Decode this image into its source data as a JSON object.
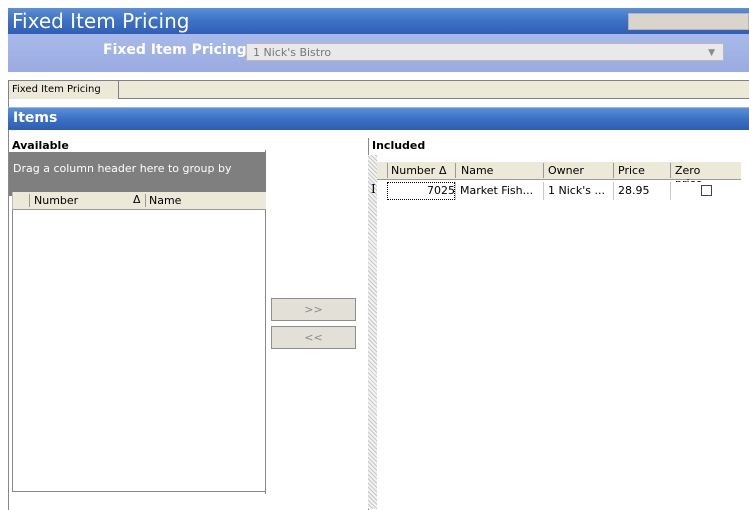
{
  "window": {
    "title": "Fixed Item Pricing"
  },
  "selector": {
    "label": "Fixed Item Pricing:",
    "value": "1  Nick's Bistro"
  },
  "tabs": [
    {
      "label": "Fixed Item Pricing"
    }
  ],
  "section": {
    "title": "Items"
  },
  "available": {
    "label": "Available",
    "group_hint": "Drag a column header here to group by",
    "columns": [
      "Number",
      "Name"
    ],
    "sort_glyph": "Δ"
  },
  "buttons": {
    "add": ">>",
    "remove": "<<"
  },
  "included": {
    "label": "Included",
    "columns": [
      "Number",
      "Name",
      "Owner",
      "Price",
      "Zero price..."
    ],
    "sort_glyph": "Δ",
    "row_marker": "I",
    "rows": [
      {
        "number": "7025",
        "name": "Market Fish...",
        "owner": "1  Nick's ...",
        "price": "28.95",
        "zero_price": false
      }
    ]
  }
}
